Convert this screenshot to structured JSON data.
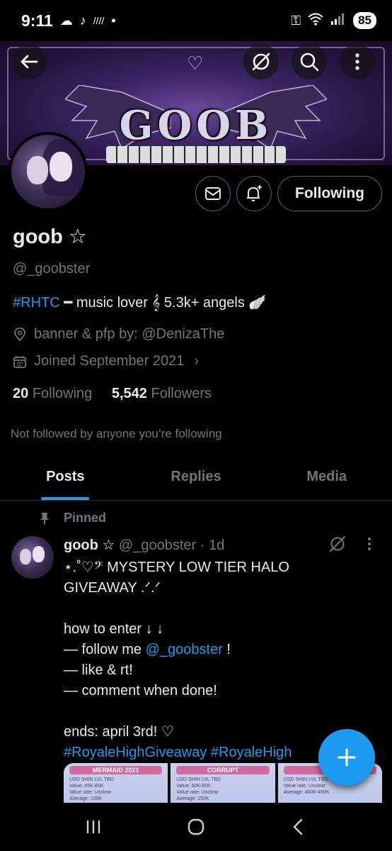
{
  "status_bar": {
    "time": "9:11",
    "battery": "85",
    "left_icons": [
      "cloud-icon",
      "tiktok-icon",
      "signal-bars-icon",
      "dot-icon"
    ],
    "right_icons": [
      "key-icon",
      "wifi-icon",
      "signal-icon",
      "battery-icon"
    ]
  },
  "banner": {
    "logo_text": "GOOB"
  },
  "profile": {
    "name": "goob ☆",
    "handle": "@_goobster",
    "bio_tag": "#RHTC",
    "bio_rest": " ━ music lover 𝄞 5.3k+ angels 🪽",
    "location": "banner & pfp by: @DenizaThe",
    "joined": "Joined September 2021",
    "following_count": "20",
    "following_label": "Following",
    "followers_count": "5,542",
    "followers_label": "Followers",
    "not_followed": "Not followed by anyone you’re following",
    "follow_button": "Following"
  },
  "tabs": [
    {
      "label": "Posts",
      "active": true
    },
    {
      "label": "Replies",
      "active": false
    },
    {
      "label": "Media",
      "active": false
    }
  ],
  "post": {
    "pinned_label": "Pinned",
    "author_name": "goob ☆",
    "author_meta": "@_goobster · 1d",
    "lines": [
      "⋆.˚♡𝄢 MYSTERY LOW TIER HALO",
      "GIVEAWAY .ᐟ.ᐟ",
      "",
      "how to enter ↓ ↓",
      "— follow me "
    ],
    "mention": "@_goobster",
    "mention_suffix": " !",
    "lines2": [
      "— like & rt!",
      "— comment when done!",
      "",
      "ends: april 3rd! ♡"
    ],
    "hashtags": "#RoyaleHighGiveaway #RoyaleHigh",
    "media_cards": [
      {
        "title": "MERMAID 2021",
        "text": "USD SHIN LVL TBD\nValue: 45K-80K\nValue rate: Unclear\nAverage: 150K"
      },
      {
        "title": "CORRUPT",
        "text": "USD SHIN LVL TBD\nValue: 50K-60K\nValue rate: Unclear\nAverage: 150K"
      },
      {
        "title": "W",
        "text": "USD SHIN LVL TBD\nValue rate: Unclear\nAverage: 400K-450K"
      }
    ]
  },
  "colors": {
    "accent": "#1d9bf0",
    "muted": "#71767b",
    "text": "#e7e9ea",
    "border": "#2f3336"
  }
}
